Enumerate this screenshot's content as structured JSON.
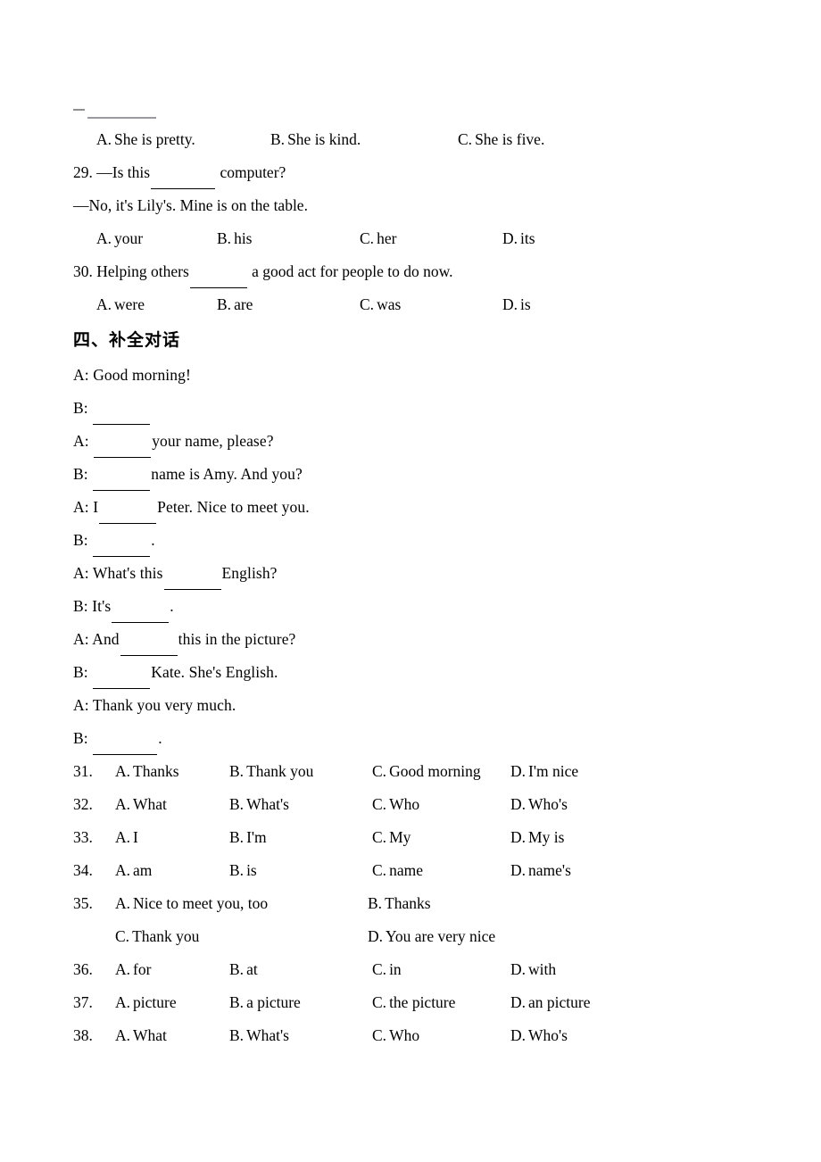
{
  "page": {
    "background_color": "#ffffff",
    "text_color": "#000000",
    "faded_text_color": "#8a8a8a"
  },
  "top_fragment": {
    "dash": "—",
    "note": "cropped trailing blank of previous question"
  },
  "question_28_options": {
    "options": [
      {
        "mark": "A.",
        "text": "She is pretty."
      },
      {
        "mark": "B.",
        "text": "She is kind."
      },
      {
        "mark": "C.",
        "text": "She is five."
      }
    ]
  },
  "question_29": {
    "number": "29.",
    "prompt_before": "—Is this",
    "prompt_after": "computer?",
    "answer_line": "—No, it's Lily's. Mine is on the table.",
    "options": [
      {
        "mark": "A.",
        "text": "your"
      },
      {
        "mark": "B.",
        "text": "his"
      },
      {
        "mark": "C.",
        "text": "her"
      },
      {
        "mark": "D.",
        "text": "its"
      }
    ]
  },
  "question_30": {
    "number": "30.",
    "prompt_before": "Helping others",
    "prompt_after": "a good act for people to do now.",
    "options": [
      {
        "mark": "A.",
        "text": "were"
      },
      {
        "mark": "B.",
        "text": "are"
      },
      {
        "mark": "C.",
        "text": "was"
      },
      {
        "mark": "D.",
        "text": "is"
      }
    ]
  },
  "section_four": {
    "heading": "四、补全对话",
    "dialogue": [
      {
        "speaker": "A:",
        "before": "Good morning!",
        "blank": false,
        "after": ""
      },
      {
        "speaker": "B:",
        "before": "",
        "blank": true,
        "after": ""
      },
      {
        "speaker": "A:",
        "before": "",
        "blank": true,
        "after": "your name, please?"
      },
      {
        "speaker": "B:",
        "before": "",
        "blank": true,
        "after": "name is Amy. And you?"
      },
      {
        "speaker": "A:",
        "before": "I",
        "blank": true,
        "after": "Peter. Nice to meet you."
      },
      {
        "speaker": "B:",
        "before": "",
        "blank": true,
        "after": "."
      },
      {
        "speaker": "A:",
        "before": "What's this",
        "blank": true,
        "after": "English?"
      },
      {
        "speaker": "B:",
        "before": "It's",
        "blank": true,
        "after": "."
      },
      {
        "speaker": "A:",
        "before": "And",
        "blank": true,
        "after": "this in the picture?"
      },
      {
        "speaker": "B:",
        "before": "",
        "blank": true,
        "after": "Kate. She's English."
      },
      {
        "speaker": "A:",
        "before": "Thank you very much.",
        "blank": false,
        "after": ""
      },
      {
        "speaker": "B:",
        "before": "",
        "blank": true,
        "after": "."
      }
    ],
    "questions": [
      {
        "number": "31.",
        "layout": "four-column",
        "options": [
          {
            "mark": "A.",
            "text": "Thanks"
          },
          {
            "mark": "B.",
            "text": "Thank you"
          },
          {
            "mark": "C.",
            "text": "Good morning"
          },
          {
            "mark": "D.",
            "text": "I'm nice"
          }
        ]
      },
      {
        "number": "32.",
        "layout": "four-column",
        "options": [
          {
            "mark": "A.",
            "text": "What"
          },
          {
            "mark": "B.",
            "text": "What's"
          },
          {
            "mark": "C.",
            "text": "Who"
          },
          {
            "mark": "D.",
            "text": "Who's"
          }
        ]
      },
      {
        "number": "33.",
        "layout": "four-column",
        "options": [
          {
            "mark": "A.",
            "text": "I"
          },
          {
            "mark": "B.",
            "text": "I'm"
          },
          {
            "mark": "C.",
            "text": "My"
          },
          {
            "mark": "D.",
            "text": "My is"
          }
        ]
      },
      {
        "number": "34.",
        "layout": "four-column",
        "options": [
          {
            "mark": "A.",
            "text": "am"
          },
          {
            "mark": "B.",
            "text": "is"
          },
          {
            "mark": "C.",
            "text": "name"
          },
          {
            "mark": "D.",
            "text": "name's"
          }
        ]
      },
      {
        "number": "35.",
        "layout": "two-column-two-row",
        "options": [
          {
            "mark": "A.",
            "text": "Nice to meet you, too"
          },
          {
            "mark": "B.",
            "text": "Thanks"
          },
          {
            "mark": "C.",
            "text": "Thank you"
          },
          {
            "mark": "D.",
            "text": "You are very nice"
          }
        ]
      },
      {
        "number": "36.",
        "layout": "four-column",
        "options": [
          {
            "mark": "A.",
            "text": "for"
          },
          {
            "mark": "B.",
            "text": "at"
          },
          {
            "mark": "C.",
            "text": "in"
          },
          {
            "mark": "D.",
            "text": "with"
          }
        ]
      },
      {
        "number": "37.",
        "layout": "four-column",
        "options": [
          {
            "mark": "A.",
            "text": "picture"
          },
          {
            "mark": "B.",
            "text": "a picture"
          },
          {
            "mark": "C.",
            "text": "the picture"
          },
          {
            "mark": "D.",
            "text": "an picture"
          }
        ]
      },
      {
        "number": "38.",
        "layout": "four-column",
        "options": [
          {
            "mark": "A.",
            "text": "What"
          },
          {
            "mark": "B.",
            "text": "What's"
          },
          {
            "mark": "C.",
            "text": "Who"
          },
          {
            "mark": "D.",
            "text": "Who's"
          }
        ]
      }
    ]
  }
}
